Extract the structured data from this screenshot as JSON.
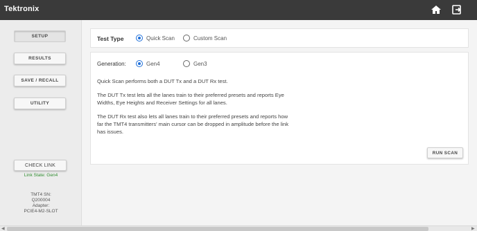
{
  "header": {
    "logo_text": "Tektronix",
    "home_icon": "home-icon",
    "exit_icon": "exit-icon"
  },
  "sidebar": {
    "buttons": [
      {
        "label": "SETUP",
        "active": true
      },
      {
        "label": "RESULTS",
        "active": false
      },
      {
        "label": "SAVE / RECALL",
        "active": false
      },
      {
        "label": "UTILITY",
        "active": false
      }
    ],
    "check_link_label": "CHECK LINK",
    "link_state": "Link State: Gen4",
    "device_info": {
      "sn_label": "TMT4 SN:",
      "sn_value": "Q200004",
      "adapter_label": "Adapter:",
      "adapter_value": "PCIE4-M2-SLOT"
    }
  },
  "test_type": {
    "label": "Test Type",
    "options": [
      {
        "label": "Quick Scan",
        "selected": true
      },
      {
        "label": "Custom Scan",
        "selected": false
      }
    ]
  },
  "generation": {
    "label": "Generation:",
    "options": [
      {
        "label": "Gen4",
        "selected": true
      },
      {
        "label": "Gen3",
        "selected": false
      }
    ]
  },
  "description": {
    "p1": "Quick Scan performs both a DUT Tx and a DUT Rx test.",
    "p2": "The DUT Tx test lets all the lanes train to their preferred presets and reports Eye Widths, Eye Heights and Receiver Settings for all lanes.",
    "p3": "The DUT Rx test also lets all lanes train to their preferred presets and reports how far the TMT4 transmitters' main cursor can be dropped in amplitude before the link has issues."
  },
  "run_scan_label": "RUN SCAN",
  "colors": {
    "header_bg": "#3a3a3a",
    "accent": "#1e6fd9",
    "link_state": "#2e8b2e"
  }
}
